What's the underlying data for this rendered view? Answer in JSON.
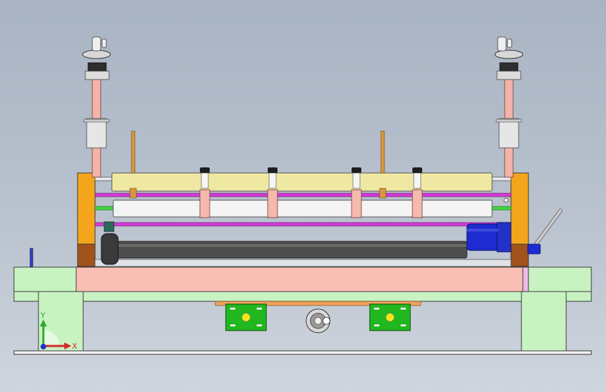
{
  "triad": {
    "x_label": "X",
    "y_label": "Y",
    "x_color": "#d42a2a",
    "y_color": "#2faa2f",
    "origin_color": "#2233cc"
  },
  "colors": {
    "frame_green": "#c8f2c2",
    "bed_pink": "#f9bfb4",
    "side_orange": "#f4a51c",
    "side_brown": "#a2521b",
    "roller_yellow": "#efe8a2",
    "roller_white": "#f4f4f4",
    "roller_dark": "#4e4e4e",
    "rail_magenta": "#d23bd6",
    "rail_green": "#3fd53f",
    "rod_pink": "#f3b3a8",
    "motor_blue": "#1d2bd0",
    "bracket_green": "#20b81e",
    "brass": "#d9973e"
  },
  "icons": {
    "handwheel_left": "handwheel-icon",
    "handwheel_right": "handwheel-icon",
    "hand_crank_bottom": "crank-wheel-icon",
    "lever": "lever-icon",
    "view_triad": "axis-triad-icon"
  }
}
